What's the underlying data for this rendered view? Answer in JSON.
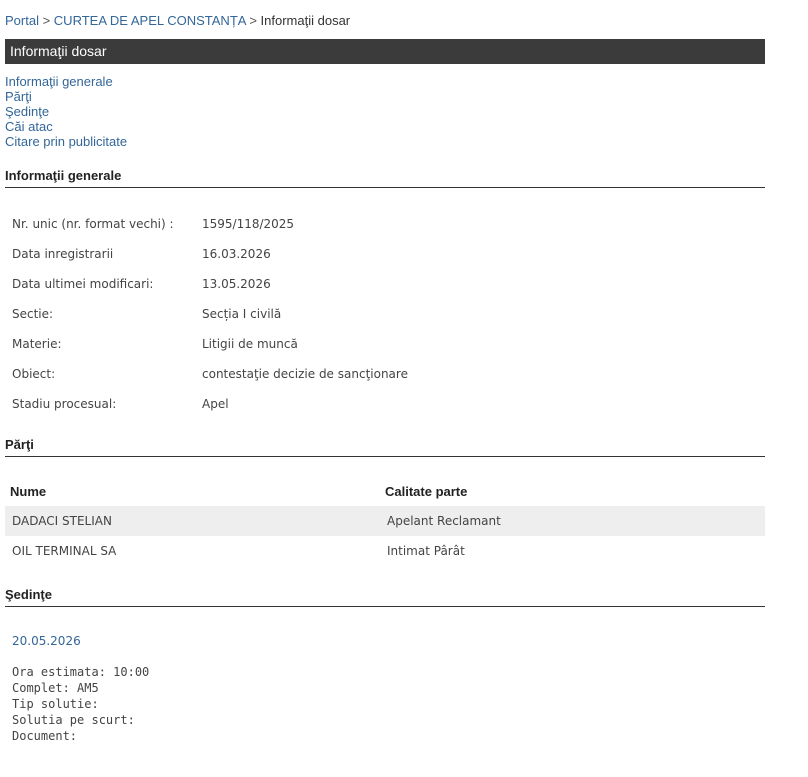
{
  "breadcrumb": {
    "portal": "Portal",
    "sep1": " > ",
    "court": "CURTEA DE APEL CONSTANȚA",
    "sep2": " > ",
    "current": "Informaţii dosar"
  },
  "title_bar": "Informaţii dosar",
  "nav_links": [
    "Informaţii generale",
    "Părţi",
    "Şedinţe",
    "Căi atac",
    "Citare prin publicitate"
  ],
  "sections": {
    "general": "Informaţii generale",
    "parties": "Părţi",
    "sessions": "Şedinţe"
  },
  "general_info": [
    {
      "label": "Nr. unic (nr. format vechi) :",
      "value": "1595/118/2025"
    },
    {
      "label": "Data inregistrarii",
      "value": "16.03.2026"
    },
    {
      "label": "Data ultimei modificari:",
      "value": "13.05.2026"
    },
    {
      "label": "Sectie:",
      "value": "Secția I civilă"
    },
    {
      "label": "Materie:",
      "value": "Litigii de muncă"
    },
    {
      "label": "Obiect:",
      "value": "contestaţie decizie de sancţionare"
    },
    {
      "label": "Stadiu procesual:",
      "value": "Apel"
    }
  ],
  "parties_table": {
    "headers": [
      "Nume",
      "Calitate parte"
    ],
    "rows": [
      [
        "DADACI STELIAN",
        "Apelant Reclamant"
      ],
      [
        "OIL TERMINAL SA",
        "Intimat Pârât"
      ]
    ]
  },
  "session": {
    "date": "20.05.2026",
    "lines": [
      "Ora estimata: 10:00",
      "Complet: AM5",
      "Tip solutie:",
      "Solutia pe scurt:",
      "Document:"
    ]
  }
}
